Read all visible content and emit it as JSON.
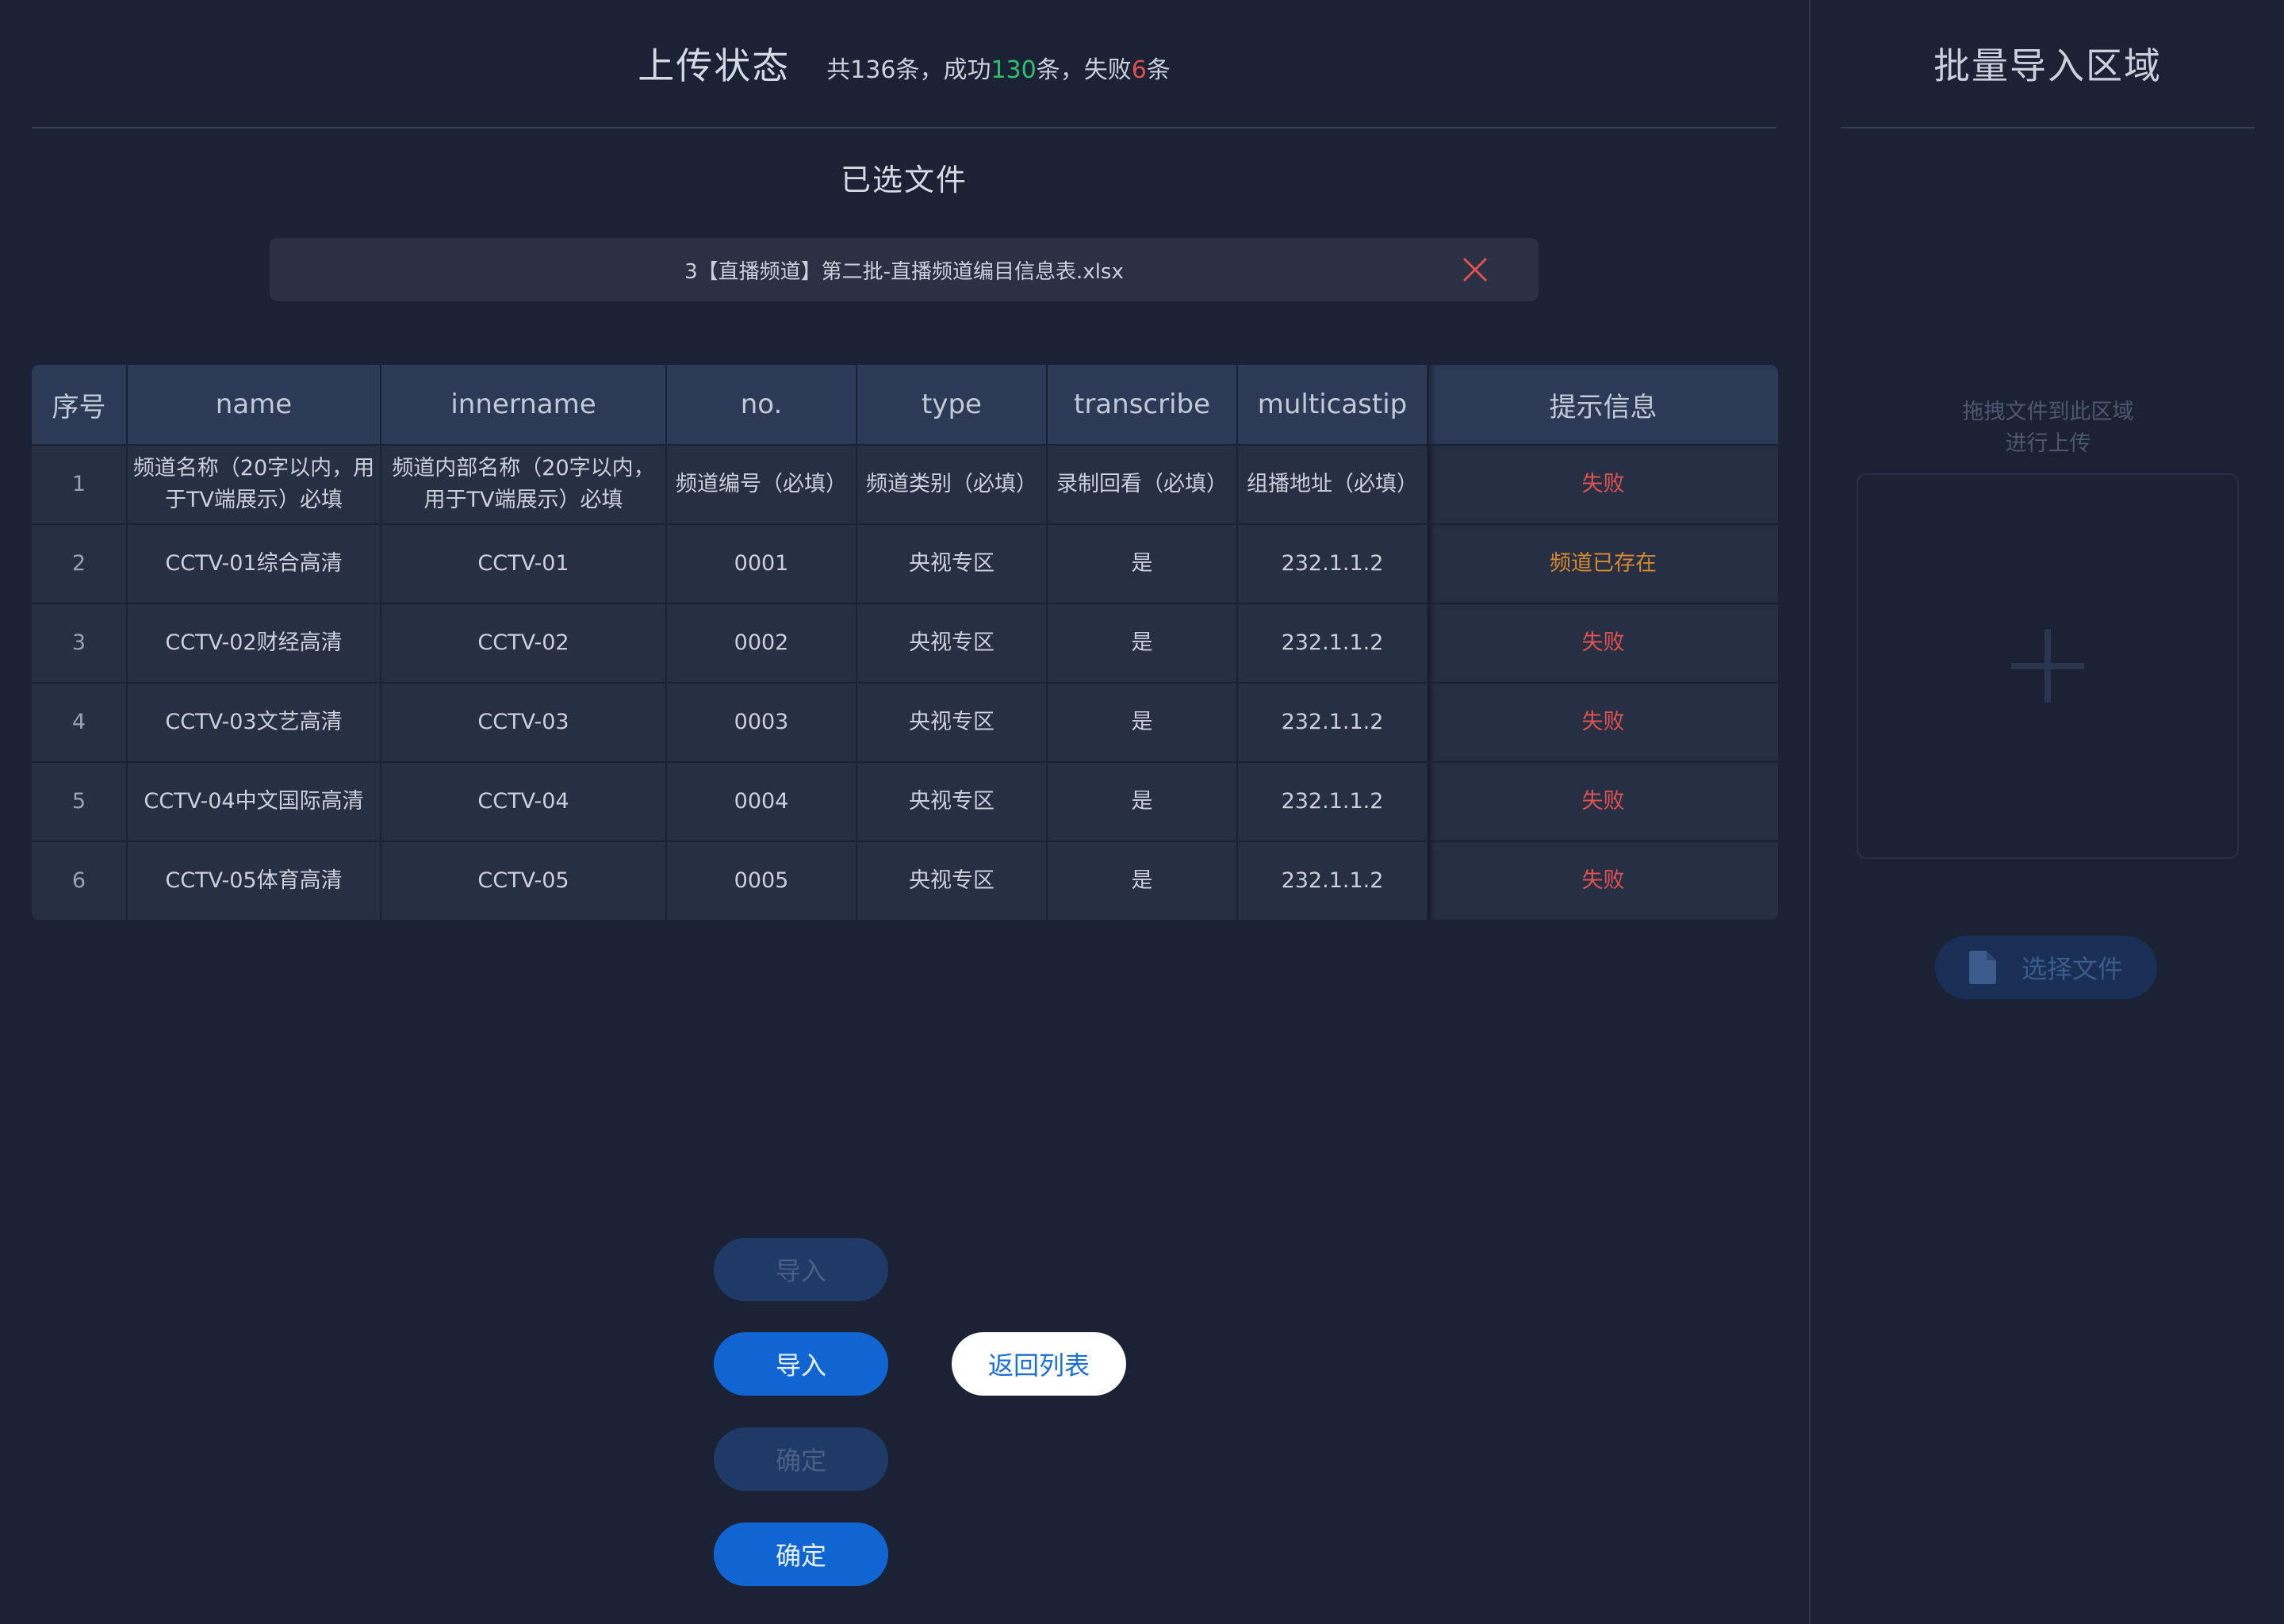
{
  "header": {
    "title": "上传状态",
    "summary_prefix": "共136条，成功",
    "success_count": "130",
    "summary_middle": "条，失败",
    "fail_count": "6",
    "summary_suffix": "条"
  },
  "selected_files": {
    "title": "已选文件",
    "file_name": "3【直播频道】第二批-直播频道编目信息表.xlsx",
    "remove_icon": "close-icon"
  },
  "table": {
    "columns": [
      "序号",
      "name",
      "innername",
      "no.",
      "type",
      "transcribe",
      "multicastip",
      "提示信息"
    ],
    "rows": [
      {
        "idx": "1",
        "name": "频道名称（20字以内，用于TV端展示）必填",
        "innername": "频道内部名称（20字以内，用于TV端展示）必填",
        "no": "频道编号（必填）",
        "type": "频道类别（必填）",
        "transcribe": "录制回看（必填）",
        "multicastip": "组播地址（必填）",
        "hint": "失败"
      },
      {
        "idx": "2",
        "name": "CCTV-01综合高清",
        "innername": "CCTV-01",
        "no": "0001",
        "type": "央视专区",
        "transcribe": "是",
        "multicastip": "232.1.1.2",
        "hint": "频道已存在"
      },
      {
        "idx": "3",
        "name": "CCTV-02财经高清",
        "innername": "CCTV-02",
        "no": "0002",
        "type": "央视专区",
        "transcribe": "是",
        "multicastip": "232.1.1.2",
        "hint": "失败"
      },
      {
        "idx": "4",
        "name": "CCTV-03文艺高清",
        "innername": "CCTV-03",
        "no": "0003",
        "type": "央视专区",
        "transcribe": "是",
        "multicastip": "232.1.1.2",
        "hint": "失败"
      },
      {
        "idx": "5",
        "name": "CCTV-04中文国际高清",
        "innername": "CCTV-04",
        "no": "0004",
        "type": "央视专区",
        "transcribe": "是",
        "multicastip": "232.1.1.2",
        "hint": "失败"
      },
      {
        "idx": "6",
        "name": "CCTV-05体育高清",
        "innername": "CCTV-05",
        "no": "0005",
        "type": "央视专区",
        "transcribe": "是",
        "multicastip": "232.1.1.2",
        "hint": "失败"
      }
    ]
  },
  "buttons": {
    "import_disabled": "导入",
    "import": "导入",
    "back_to_list": "返回列表",
    "confirm_disabled": "确定",
    "confirm": "确定"
  },
  "bulk_import": {
    "title": "批量导入区域",
    "drop_hint_line1": "拖拽文件到此区域",
    "drop_hint_line2": "进行上传",
    "plus_icon": "plus-icon",
    "choose_file_label": "选择文件",
    "file_icon": "file-icon"
  },
  "colors": {
    "background": "#1c2235",
    "success": "#2fbf71",
    "fail": "#e0524f",
    "warning": "#d6882f",
    "primary": "#1165d3"
  }
}
